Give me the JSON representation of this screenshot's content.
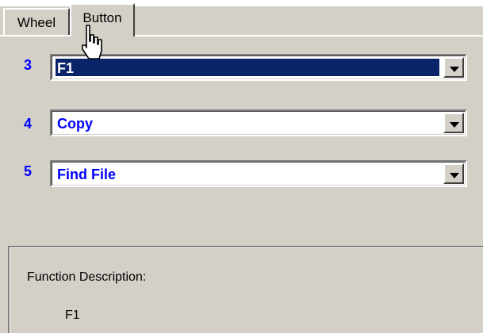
{
  "tabs": [
    {
      "label": "Wheel",
      "active": false
    },
    {
      "label": "Button",
      "active": true
    }
  ],
  "rows": [
    {
      "number": "3",
      "value": "F1",
      "selected": true
    },
    {
      "number": "4",
      "value": "Copy",
      "selected": false
    },
    {
      "number": "5",
      "value": "Find File",
      "selected": false
    }
  ],
  "description": {
    "label": "Function Description:",
    "value": "F1"
  },
  "colors": {
    "face": "#d4d0c8",
    "selection": "#0a246a",
    "accent_text": "#0000ff"
  },
  "icons": {
    "cursor": "hand-pointer-icon",
    "dropdown": "dropdown-arrow-icon"
  }
}
